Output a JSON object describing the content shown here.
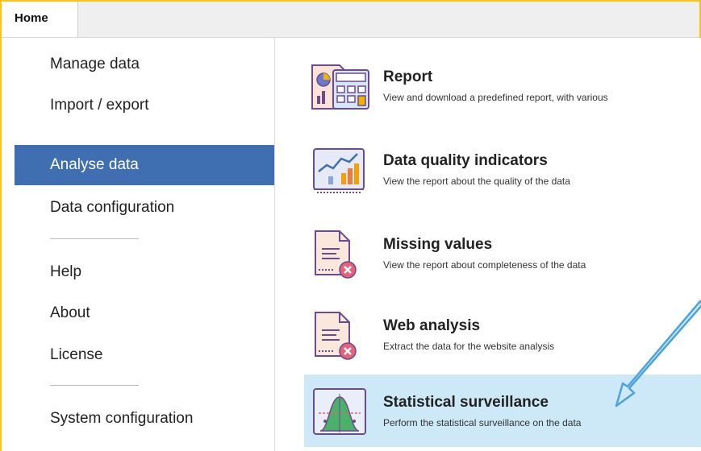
{
  "tabs": {
    "home_label": "Home"
  },
  "sidebar": {
    "items": [
      {
        "label": "Manage data"
      },
      {
        "label": "Import / export"
      },
      {
        "label": "Analyse data"
      },
      {
        "label": "Data configuration"
      },
      {
        "label": "Help"
      },
      {
        "label": "About"
      },
      {
        "label": "License"
      },
      {
        "label": "System configuration"
      }
    ],
    "active_item": "Analyse data"
  },
  "main": {
    "tools": [
      {
        "title": "Report",
        "description": "View and download a predefined report, with various",
        "icon": "report-icon"
      },
      {
        "title": "Data quality indicators",
        "description": "View the report about the quality of the data",
        "icon": "data-quality-chart-icon"
      },
      {
        "title": "Missing values",
        "description": "View the report about completeness of the data",
        "icon": "document-error-icon"
      },
      {
        "title": "Web analysis",
        "description": "Extract the data for the website analysis",
        "icon": "document-error-icon"
      },
      {
        "title": "Statistical surveillance",
        "description": "Perform the statistical surveillance on the data",
        "icon": "bell-curve-chart-icon"
      }
    ],
    "selected_tool": "Statistical surveillance"
  },
  "colors": {
    "frame_border": "#f5c518",
    "sidebar_active_bg": "#3f6fb0",
    "selected_tool_bg": "#cde8f7",
    "annotation_arrow": "#4aa3df"
  }
}
